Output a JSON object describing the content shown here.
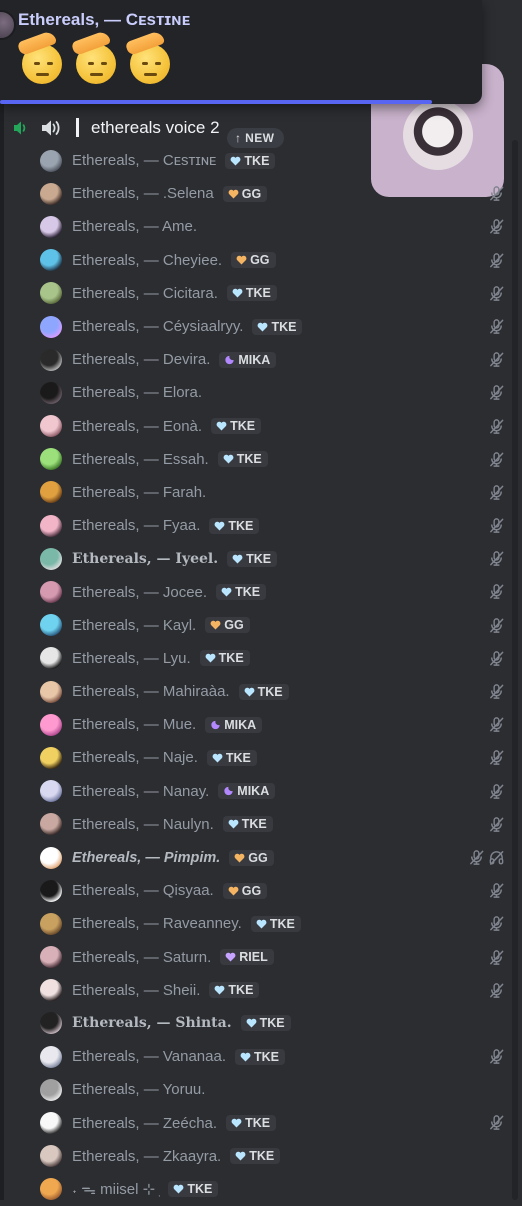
{
  "notification": {
    "author": "Ethereals, — Cᴇsᴛɪɴᴇ",
    "emojis": [
      "saluting-face",
      "saluting-face",
      "saluting-face"
    ]
  },
  "channel": {
    "name": "ethereals voice 2",
    "new_label": "↑ NEW"
  },
  "colors": {
    "tke": "#b9e6fe",
    "gg": "#f5b461",
    "mika": "#b388ff",
    "riel": "#c6a4ff",
    "accent": "#5865f2",
    "voice_green": "#23a55a"
  },
  "members": [
    {
      "name": "Ethereals, — Cᴇsᴛɪɴᴇ",
      "tag": "TKE",
      "style": "normal",
      "muted": false,
      "deafened": false
    },
    {
      "name": "Ethereals, — .Selena",
      "tag": "GG",
      "style": "normal",
      "muted": true,
      "deafened": false
    },
    {
      "name": "Ethereals, — Ame.",
      "tag": "",
      "style": "normal",
      "muted": true,
      "deafened": false
    },
    {
      "name": "Ethereals, — Cheyiee.",
      "tag": "GG",
      "style": "normal",
      "muted": true,
      "deafened": false
    },
    {
      "name": "Ethereals, — Cicitara.",
      "tag": "TKE",
      "style": "normal",
      "muted": true,
      "deafened": false
    },
    {
      "name": "Ethereals, — Céysiaalryy.",
      "tag": "TKE",
      "style": "normal",
      "muted": true,
      "deafened": false
    },
    {
      "name": "Ethereals, — Devira.",
      "tag": "MIKA",
      "style": "normal",
      "muted": true,
      "deafened": false
    },
    {
      "name": "Ethereals, — Elora.",
      "tag": "",
      "style": "normal",
      "muted": true,
      "deafened": false
    },
    {
      "name": "Ethereals, — Eonà.",
      "tag": "TKE",
      "style": "normal",
      "muted": true,
      "deafened": false
    },
    {
      "name": "Ethereals, — Essah.",
      "tag": "TKE",
      "style": "normal",
      "muted": true,
      "deafened": false
    },
    {
      "name": "Ethereals, — Farah.",
      "tag": "",
      "style": "normal",
      "muted": true,
      "deafened": false
    },
    {
      "name": "Ethereals, — Fyaa.",
      "tag": "TKE",
      "style": "normal",
      "muted": true,
      "deafened": false
    },
    {
      "name": "Ethereals, — Iyeel.",
      "tag": "TKE",
      "style": "bold",
      "muted": true,
      "deafened": false
    },
    {
      "name": "Ethereals, — Jocee.",
      "tag": "TKE",
      "style": "normal",
      "muted": true,
      "deafened": false
    },
    {
      "name": "Ethereals, — Kayl.",
      "tag": "GG",
      "style": "normal",
      "muted": true,
      "deafened": false
    },
    {
      "name": "Ethereals, — Lyu.",
      "tag": "TKE",
      "style": "normal",
      "muted": true,
      "deafened": false
    },
    {
      "name": "Ethereals, — Mahiraàa.",
      "tag": "TKE",
      "style": "normal",
      "muted": true,
      "deafened": false
    },
    {
      "name": "Ethereals, — Mue.",
      "tag": "MIKA",
      "style": "normal",
      "muted": true,
      "deafened": false
    },
    {
      "name": "Ethereals, — Naje.",
      "tag": "TKE",
      "style": "normal",
      "muted": true,
      "deafened": false
    },
    {
      "name": "Ethereals, — Nanay.",
      "tag": "MIKA",
      "style": "normal",
      "muted": true,
      "deafened": false
    },
    {
      "name": "Ethereals, — Naulyn.",
      "tag": "TKE",
      "style": "normal",
      "muted": true,
      "deafened": false
    },
    {
      "name": "Ethereals, — Pimpim.",
      "tag": "GG",
      "style": "bold-italic",
      "muted": true,
      "deafened": true
    },
    {
      "name": "Ethereals, — Qisyaa.",
      "tag": "GG",
      "style": "normal",
      "muted": true,
      "deafened": false
    },
    {
      "name": "Ethereals, — Raveanney.",
      "tag": "TKE",
      "style": "normal",
      "muted": true,
      "deafened": false
    },
    {
      "name": "Ethereals, — Saturn.",
      "tag": "RIEL",
      "style": "normal",
      "muted": true,
      "deafened": false
    },
    {
      "name": "Ethereals, — Sheii.",
      "tag": "TKE",
      "style": "normal",
      "muted": true,
      "deafened": false
    },
    {
      "name": "Ethereals, — Shinta.",
      "tag": "TKE",
      "style": "bold",
      "muted": false,
      "deafened": false
    },
    {
      "name": "Ethereals, — Vananaa.",
      "tag": "TKE",
      "style": "normal",
      "muted": true,
      "deafened": false
    },
    {
      "name": "Ethereals, — Yoruu.",
      "tag": "",
      "style": "normal",
      "muted": false,
      "deafened": false
    },
    {
      "name": "Ethereals, — Zeécha.",
      "tag": "TKE",
      "style": "normal",
      "muted": true,
      "deafened": false
    },
    {
      "name": "Ethereals, — Zkaayra.",
      "tag": "TKE",
      "style": "normal",
      "muted": false,
      "deafened": false
    },
    {
      "name": "˖ ᯓ miisel ⊹ ִ",
      "tag": "TKE",
      "style": "normal",
      "muted": false,
      "deafened": false
    }
  ]
}
